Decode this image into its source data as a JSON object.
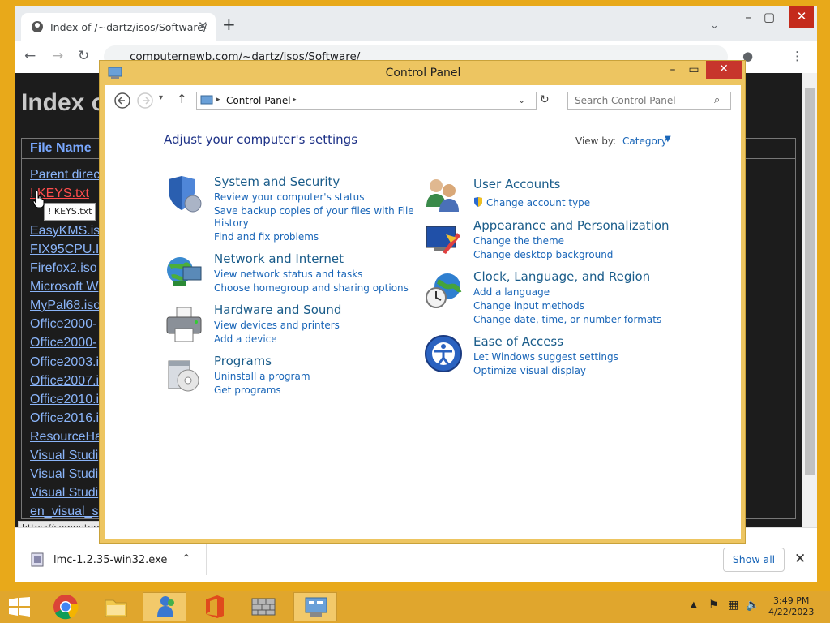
{
  "browser": {
    "tab_title": "Index of /~dartz/isos/Software/",
    "url": "computernewb.com/~dartz/isos/Software/",
    "status_url": "https://computerne"
  },
  "page": {
    "heading": "Index o",
    "column_header": "File Name",
    "files": [
      "Parent direc",
      "! KEYS.txt",
      "",
      "EasyKMS.is",
      "FIX95CPU.I",
      "Firefox2.iso",
      "Microsoft W",
      "MyPal68.iso",
      "Office2000-",
      "Office2000-",
      "Office2003.i",
      "Office2007.i",
      "Office2010.i",
      "Office2016.i",
      "ResourceHa",
      "Visual Studi",
      "Visual Studi",
      "Visual Studi",
      "en_visual_s"
    ],
    "tooltip": "! KEYS.txt"
  },
  "download": {
    "file": "lmc-1.2.35-win32.exe",
    "show_all": "Show all"
  },
  "control_panel": {
    "title": "Control Panel",
    "breadcrumb": "Control Panel",
    "search_placeholder": "Search Control Panel",
    "heading": "Adjust your computer's settings",
    "view_by_label": "View by:",
    "view_by_value": "Category",
    "categories_left": [
      {
        "title": "System and Security",
        "links": [
          "Review your computer's status",
          "Save backup copies of your files with File",
          "History",
          "Find and fix problems"
        ]
      },
      {
        "title": "Network and Internet",
        "links": [
          "View network status and tasks",
          "Choose homegroup and sharing options"
        ]
      },
      {
        "title": "Hardware and Sound",
        "links": [
          "View devices and printers",
          "Add a device"
        ]
      },
      {
        "title": "Programs",
        "links": [
          "Uninstall a program",
          "Get programs"
        ]
      }
    ],
    "categories_right": [
      {
        "title": "User Accounts",
        "links": [
          "Change account type"
        ]
      },
      {
        "title": "Appearance and Personalization",
        "links": [
          "Change the theme",
          "Change desktop background"
        ]
      },
      {
        "title": "Clock, Language, and Region",
        "links": [
          "Add a language",
          "Change input methods",
          "Change date, time, or number formats"
        ]
      },
      {
        "title": "Ease of Access",
        "links": [
          "Let Windows suggest settings",
          "Optimize visual display"
        ]
      }
    ]
  },
  "taskbar": {
    "time": "3:49 PM",
    "date": "4/22/2023"
  },
  "colors": {
    "window_frame": "#edc561",
    "taskbar": "#e0a62d",
    "close_button": "#c7352c",
    "link": "#1a66b8"
  }
}
